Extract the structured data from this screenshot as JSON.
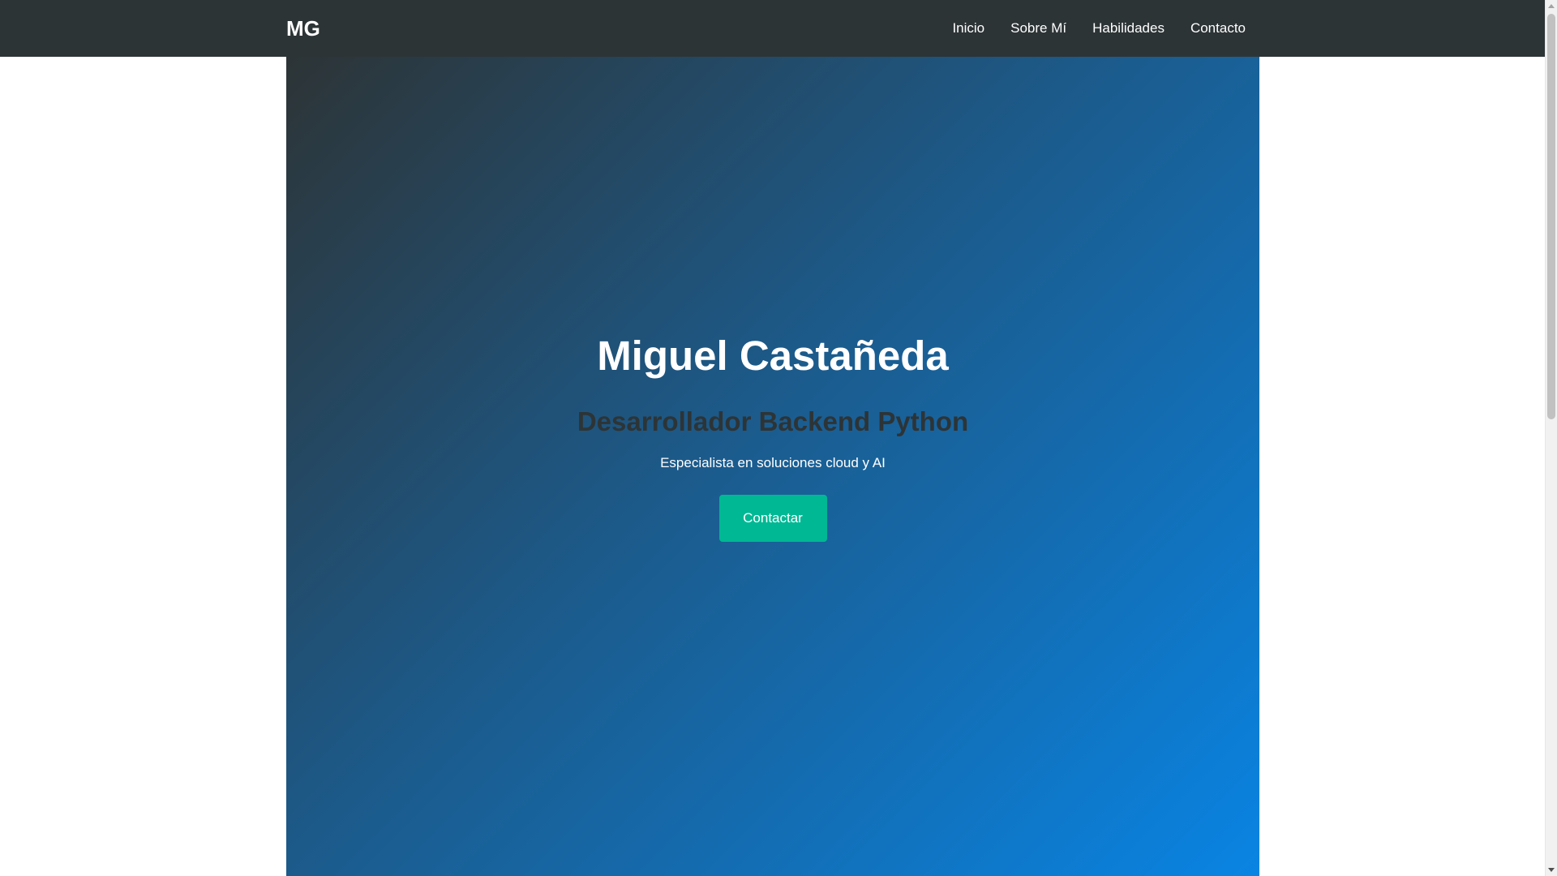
{
  "navbar": {
    "brand": "MG",
    "links": [
      {
        "label": "Inicio"
      },
      {
        "label": "Sobre Mí"
      },
      {
        "label": "Habilidades"
      },
      {
        "label": "Contacto"
      }
    ]
  },
  "hero": {
    "title": "Miguel Castañeda",
    "subtitle": "Desarrollador Backend Python",
    "tagline": "Especialista en soluciones cloud y AI",
    "button_label": "Contactar"
  },
  "colors": {
    "navbar_bg": "#2d3436",
    "gradient_start": "#2d3436",
    "gradient_end": "#0984e3",
    "button_bg": "#00b894",
    "subtitle_text": "#2d3436"
  }
}
